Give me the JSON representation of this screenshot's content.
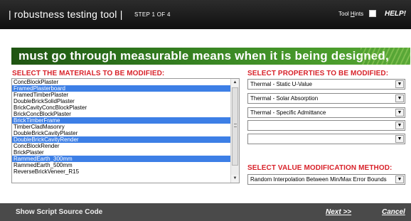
{
  "header": {
    "app_title": "| robustness testing tool |",
    "step_label": "STEP 1 OF 4",
    "tool_hints_label": "Tool Hints",
    "tool_hints_checked": false,
    "help_label": "HELP!"
  },
  "banner": {
    "text": "must go through measurable means when it is being designed,"
  },
  "materials": {
    "heading": "SELECT THE MATERIALS TO BE MODIFIED:",
    "items": [
      {
        "label": "ConcBlockPlaster",
        "selected": false
      },
      {
        "label": "FramedPlasterboard",
        "selected": true
      },
      {
        "label": "FramedTimberPlaster",
        "selected": false
      },
      {
        "label": "DoubleBrickSolidPlaster",
        "selected": false
      },
      {
        "label": "BrickCavityConcBlockPlaster",
        "selected": false
      },
      {
        "label": "BrickConcBlockPlaster",
        "selected": false
      },
      {
        "label": "BrickTimberFrame",
        "selected": true
      },
      {
        "label": "TimberCladMasonry",
        "selected": false
      },
      {
        "label": "DoubleBrickCavityPlaster",
        "selected": false
      },
      {
        "label": "DoubleBrickCavityRender",
        "selected": true
      },
      {
        "label": "ConcBlockRender",
        "selected": false
      },
      {
        "label": "BrickPlaster",
        "selected": false
      },
      {
        "label": "RammedEarth_300mm",
        "selected": true
      },
      {
        "label": "RammedEarth_500mm",
        "selected": false
      },
      {
        "label": "ReverseBrickVeneer_R15",
        "selected": false
      }
    ]
  },
  "properties": {
    "heading": "SELECT PROPERTIES TO BE MODIFIED:",
    "selects": [
      {
        "value": "Thermal - Static U-Value"
      },
      {
        "value": "Thermal - Solar Absorption"
      },
      {
        "value": "Thermal - Specific Admittance"
      },
      {
        "value": ""
      },
      {
        "value": ""
      }
    ]
  },
  "method": {
    "heading": "SELECT VALUE MODIFICATION METHOD:",
    "value": "Random Interpolation Between Min/Max Error Bounds"
  },
  "footer": {
    "show_script_label": "Show Script Source Code",
    "next_label": "Next >>",
    "cancel_label": "Cancel"
  },
  "colors": {
    "heading_red": "#d8222a",
    "selection_blue": "#3d7fe6",
    "banner_green": "#2a6e1a",
    "footer_gray": "#4a4a4a"
  }
}
